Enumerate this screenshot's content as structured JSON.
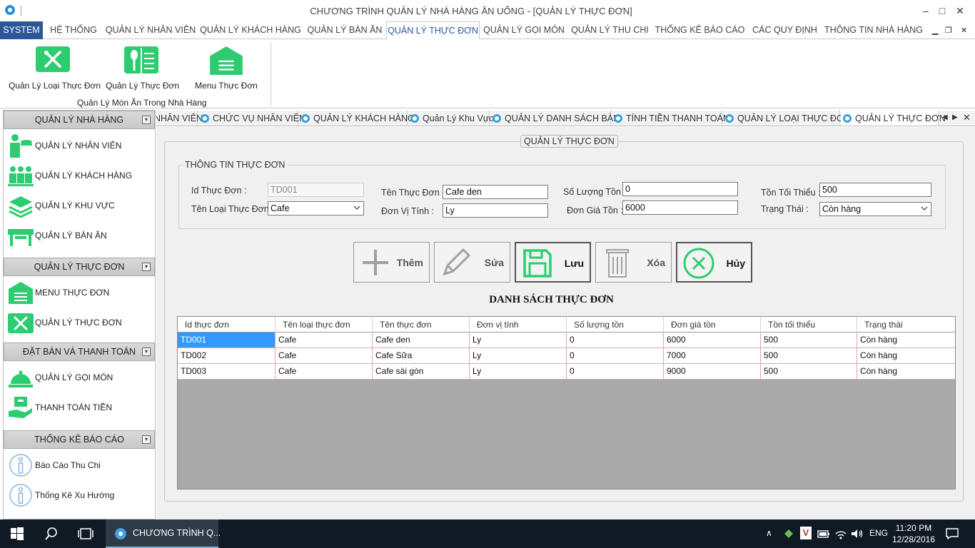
{
  "window": {
    "title": "CHƯƠNG TRÌNH QUẢN LÝ NHÀ HÀNG ĂN UỐNG - [QUẢN LÝ THỰC ĐƠN]"
  },
  "ribbon_tabs": [
    "SYSTEM",
    "HỆ THỐNG",
    "QUẢN LÝ NHÂN VIÊN",
    "QUẢN LÝ KHÁCH HÀNG",
    "QUẢN LÝ BÀN ĂN",
    "QUẢN LÝ THỰC ĐƠN",
    "QUẢN LÝ GỌI MÓN",
    "QUẢN LÝ THU CHI",
    "THỐNG KÊ BÁO CÁO",
    "CÁC QUY ĐỊNH",
    "THÔNG TIN NHÀ HÀNG"
  ],
  "ribbon": {
    "buttons": [
      "Quản Lý Loại Thực Đơn",
      "Quản Lý Thực Đơn",
      "Menu Thực Đơn"
    ],
    "group_label": "Quản Lý  Món Ăn Trong Nhà Hàng"
  },
  "nav": {
    "groups": [
      "QUẢN LÝ NHÀ HÀNG",
      "QUẢN LÝ THỰC ĐƠN",
      "ĐẶT BÀN VÀ THANH TOÁN",
      "THỐNG KÊ BÁO CÁO"
    ],
    "items": [
      "QUẢN LÝ NHÂN VIÊN",
      "QUẢN LÝ KHÁCH HÀNG",
      "QUẢN LÝ KHU VỰC",
      "QUẢN LÝ BÀN ĂN",
      "MENU THỰC ĐƠN",
      "QUẢN LÝ THỰC ĐƠN",
      "QUẢN LÝ GỌI MÓN",
      "THANH TOÁN TIỀN",
      "Báo Cáo Thu Chi",
      "Thống Kê Xu Hướng"
    ]
  },
  "doc_tabs": [
    "NHÂN VIÊN",
    "CHỨC VỤ NHÂN VIÊN",
    "QUẢN LÝ KHÁCH HÀNG",
    "Quản Lý Khu Vực",
    "QUẢN LÝ DANH SÁCH BÀN",
    "TÍNH TIỀN THANH TOÁN",
    "QUẢN LÝ LOẠI THỰC ĐƠN",
    "QUẢN LÝ THỰC ĐƠN"
  ],
  "form": {
    "outer_title": "QUẢN LÝ THỰC ĐƠN",
    "info_title": "THÔNG TIN THỰC ĐƠN",
    "labels": {
      "id": "Id Thực Đơn :",
      "category": "Tên Loại Thực Đơn :",
      "name": "Tên Thực Đơn :",
      "unit": "Đơn Vị Tính :",
      "stock": "Số Lượng Tồn :",
      "price": "Đơn Giá Tồn :",
      "min_stock": "Tồn Tối Thiểu :",
      "status": "Trạng Thái :"
    },
    "values": {
      "id": "TD001",
      "category": "Cafe",
      "name": "Cafe den",
      "unit": "Ly",
      "stock": "0",
      "price": "6000",
      "min_stock": "500",
      "status": "Còn hàng"
    }
  },
  "actions": [
    "Thêm",
    "Sửa",
    "Lưu",
    "Xóa",
    "Hủy"
  ],
  "list_title": "DANH SÁCH  THỰC ĐƠN",
  "grid": {
    "columns": [
      "Id thực đơn",
      "Tên loại thực đơn",
      "Tên thực đơn",
      "Đơn vị tính",
      "Số lượng tồn",
      "Đơn giá tồn",
      "Tồn tối thiểu",
      "Trạng thái"
    ],
    "rows": [
      [
        "TD001",
        "Cafe",
        "Cafe den",
        "Ly",
        "0",
        "6000",
        "500",
        "Còn hàng"
      ],
      [
        "TD002",
        "Cafe",
        "Cafe Sữa",
        "Ly",
        "0",
        "7000",
        "500",
        "Còn hàng"
      ],
      [
        "TD003",
        "Cafe",
        "Cafe sài gòn",
        "Ly",
        "0",
        "9000",
        "500",
        "Còn hàng"
      ]
    ]
  },
  "taskbar": {
    "app_label": "CHƯƠNG TRÌNH Q...",
    "lang": "ENG",
    "time": "11:20 PM",
    "date": "12/28/2016"
  },
  "colors": {
    "accent": "#2b579a",
    "icon_green": "#2ecc71",
    "selected": "#3399ff"
  }
}
